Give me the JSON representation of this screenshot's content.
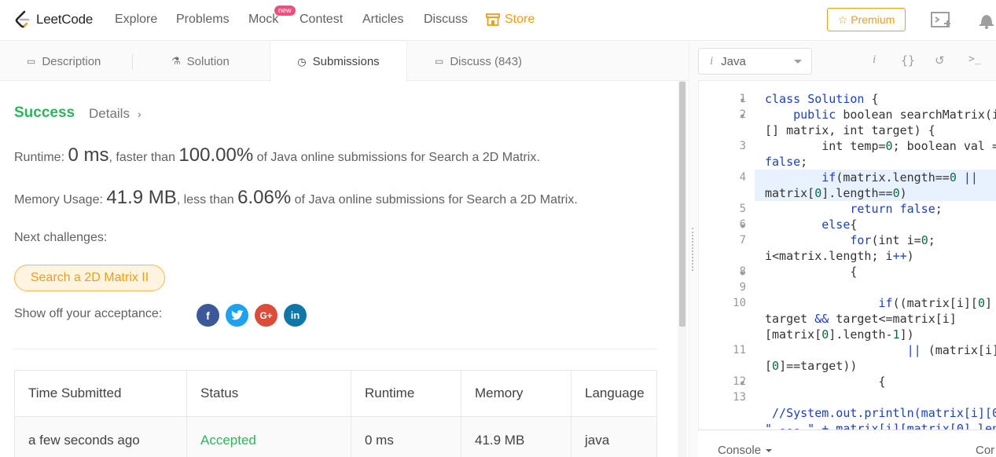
{
  "nav": {
    "logo": "LeetCode",
    "explore": "Explore",
    "problems": "Problems",
    "mock": "Mock",
    "mock_badge": "new",
    "contest": "Contest",
    "articles": "Articles",
    "discuss": "Discuss",
    "store": "Store",
    "premium": "Premium",
    "accent": "#f29c1b"
  },
  "tabs": {
    "description": "Description",
    "solution": "Solution",
    "submissions": "Submissions",
    "discuss": "Discuss (843)"
  },
  "result": {
    "status": "Success",
    "details": "Details",
    "runtime_label": "Runtime: ",
    "runtime_value": "0 ms",
    "runtime_mid": ", faster than ",
    "runtime_pct": "100.00%",
    "runtime_tail": " of Java online submissions for Search a 2D Matrix.",
    "memory_label": "Memory Usage: ",
    "memory_value": "41.9 MB",
    "memory_mid": ", less than ",
    "memory_pct": "6.06%",
    "memory_tail": " of Java online submissions for Search a 2D Matrix.",
    "next_label": "Next challenges:",
    "next_challenge": "Search a 2D Matrix II",
    "share_label": "Show off your acceptance:",
    "social": [
      "facebook-icon",
      "twitter-icon",
      "google-plus-icon",
      "linkedin-icon"
    ]
  },
  "table": {
    "headers": [
      "Time Submitted",
      "Status",
      "Runtime",
      "Memory",
      "Language"
    ],
    "row": [
      "a few seconds ago",
      "Accepted",
      "0 ms",
      "41.9 MB",
      "java"
    ]
  },
  "editor": {
    "language": "Java",
    "lang_glyph": "i",
    "console": "Console",
    "contribute": "Cor",
    "line_numbers": [
      "1",
      "2",
      "3",
      "4",
      "5",
      "6",
      "7",
      "8",
      "9",
      "10",
      "11",
      "12",
      "13"
    ]
  }
}
